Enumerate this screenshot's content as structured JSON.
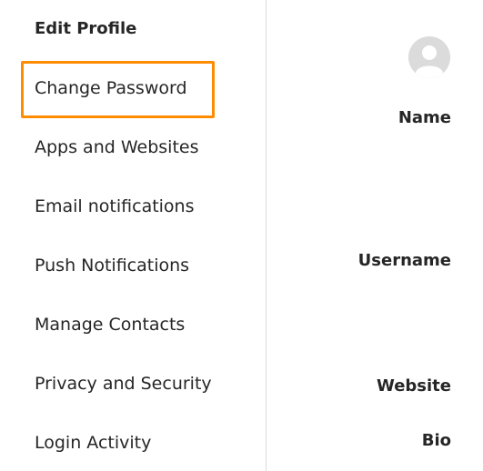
{
  "sidebar": {
    "items": [
      {
        "label": "Edit Profile"
      },
      {
        "label": "Change Password"
      },
      {
        "label": "Apps and Websites"
      },
      {
        "label": "Email notifications"
      },
      {
        "label": "Push Notifications"
      },
      {
        "label": "Manage Contacts"
      },
      {
        "label": "Privacy and Security"
      },
      {
        "label": "Login Activity"
      }
    ]
  },
  "main": {
    "avatar_icon": "default-avatar-icon",
    "fields": {
      "name_label": "Name",
      "username_label": "Username",
      "website_label": "Website",
      "bio_label": "Bio"
    }
  },
  "colors": {
    "highlight": "#ff8c00",
    "text": "#262626",
    "divider": "#dbdbdb"
  }
}
